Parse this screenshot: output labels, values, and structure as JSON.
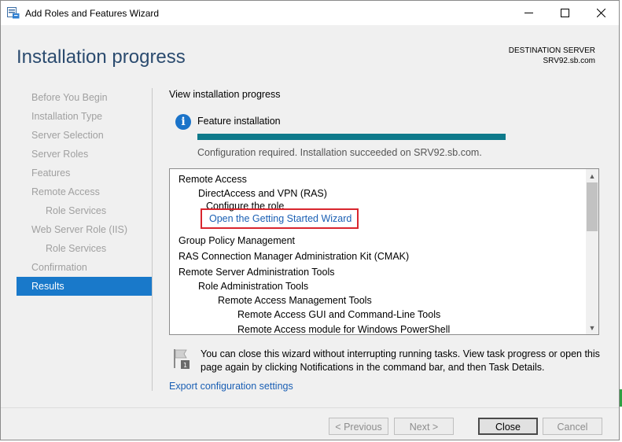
{
  "window": {
    "title": "Add Roles and Features Wizard"
  },
  "header": {
    "page_title": "Installation progress",
    "destination_label": "DESTINATION SERVER",
    "destination_server": "SRV92.sb.com"
  },
  "nav": {
    "items": [
      {
        "label": "Before You Begin",
        "level": 0,
        "active": false
      },
      {
        "label": "Installation Type",
        "level": 0,
        "active": false
      },
      {
        "label": "Server Selection",
        "level": 0,
        "active": false
      },
      {
        "label": "Server Roles",
        "level": 0,
        "active": false
      },
      {
        "label": "Features",
        "level": 0,
        "active": false
      },
      {
        "label": "Remote Access",
        "level": 0,
        "active": false
      },
      {
        "label": "Role Services",
        "level": 1,
        "active": false
      },
      {
        "label": "Web Server Role (IIS)",
        "level": 0,
        "active": false
      },
      {
        "label": "Role Services",
        "level": 1,
        "active": false
      },
      {
        "label": "Confirmation",
        "level": 0,
        "active": false
      },
      {
        "label": "Results",
        "level": 0,
        "active": true
      }
    ]
  },
  "main": {
    "view_label": "View installation progress",
    "feature_label": "Feature installation",
    "progress_fraction": 1.0,
    "progress_color": "#0e7a8b",
    "status_text": "Configuration required. Installation succeeded on SRV92.sb.com.",
    "results": [
      {
        "label": "Remote Access",
        "level": 0
      },
      {
        "label": "DirectAccess and VPN (RAS)",
        "level": 1
      },
      {
        "label": "Configure the role",
        "level": "cfg"
      },
      {
        "label": "Open the Getting Started Wizard",
        "level": "link"
      },
      {
        "label": "Group Policy Management",
        "level": 0
      },
      {
        "label": "RAS Connection Manager Administration Kit (CMAK)",
        "level": 0
      },
      {
        "label": "Remote Server Administration Tools",
        "level": 0
      },
      {
        "label": "Role Administration Tools",
        "level": 1
      },
      {
        "label": "Remote Access Management Tools",
        "level": 2
      },
      {
        "label": "Remote Access GUI and Command-Line Tools",
        "level": 3
      },
      {
        "label": "Remote Access module for Windows PowerShell",
        "level": 3
      }
    ],
    "note_text": "You can close this wizard without interrupting running tasks. View task progress or open this page again by clicking Notifications in the command bar, and then Task Details.",
    "export_link": "Export configuration settings"
  },
  "footer": {
    "previous_label": "< Previous",
    "next_label": "Next >",
    "close_label": "Close",
    "cancel_label": "Cancel"
  },
  "colors": {
    "accent": "#1979ca",
    "title": "#2b4b6f",
    "highlight_box": "#d9262e",
    "link": "#1a5fb4"
  }
}
